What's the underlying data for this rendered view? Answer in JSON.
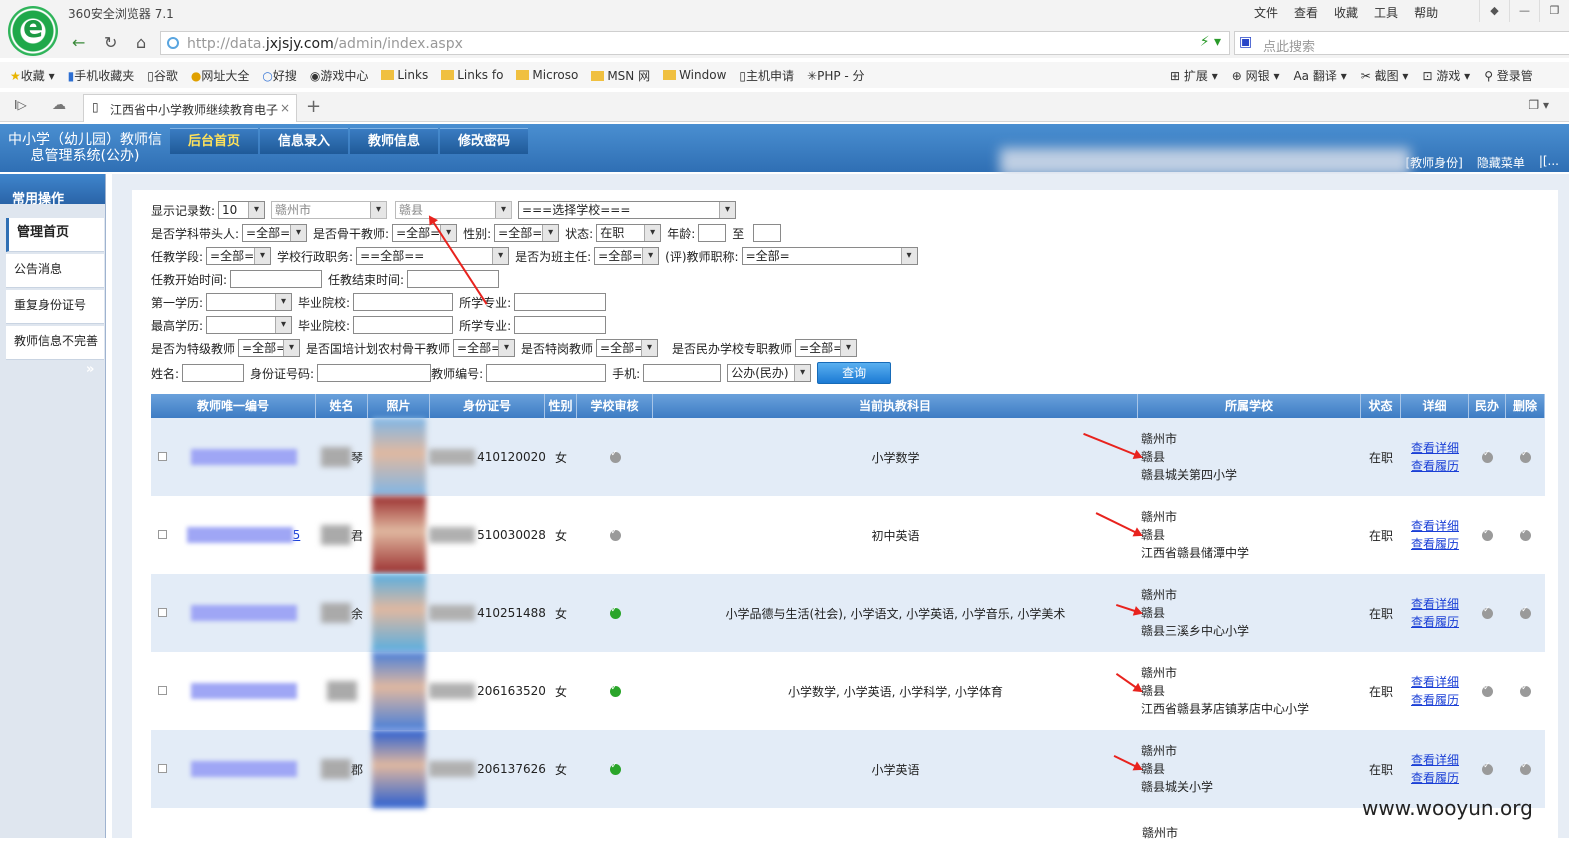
{
  "browser": {
    "app_title": "360安全浏览器 7.1",
    "menu": [
      "文件",
      "查看",
      "收藏",
      "工具",
      "帮助"
    ],
    "url_prefix": "http://data.",
    "url_domain": "jxjsjy.com",
    "url_path": "/admin/index.aspx",
    "search_placeholder": "点此搜索",
    "bookmarks": [
      "收藏",
      "手机收藏夹",
      "谷歌",
      "网址大全",
      "好搜",
      "游戏中心",
      "Links",
      "Links fo",
      "Microso",
      "MSN 网",
      "Window",
      "主机申请",
      "PHP - 分"
    ],
    "bookmarks_right": [
      "扩展",
      "网银",
      "翻译",
      "截图",
      "游戏",
      "登录管"
    ],
    "tab_title": "江西省中小学教师继续教育电子"
  },
  "site": {
    "title": "中小学（幼儿园）教师信息管理系统(公办)",
    "nav": [
      "后台首页",
      "信息录入",
      "教师信息",
      "修改密码"
    ],
    "header_links": [
      "[教师身份]",
      "隐藏菜单",
      "|[..."
    ]
  },
  "sidebar": {
    "heading": "常用操作",
    "items": [
      "管理首页",
      "公告消息",
      "重复身份证号",
      "教师信息不完善"
    ]
  },
  "filters": {
    "row1": {
      "label": "显示记录数:",
      "count": "10",
      "city": "赣州市",
      "county": "赣县",
      "school": "===选择学校==="
    },
    "row2": {
      "l1": "是否学科带头人:",
      "v1": "=全部=",
      "l2": "是否骨干教师:",
      "v2": "=全部=",
      "l3": "性别:",
      "v3": "=全部=",
      "l4": "状态:",
      "v4": "在职",
      "l5": "年龄:",
      "l6": "至"
    },
    "row3": {
      "l1": "任教学段:",
      "v1": "=全部=",
      "l2": "学校行政职务:",
      "v2": "==全部==",
      "l3": "是否为班主任:",
      "v3": "=全部=",
      "l4": "(评)教师职称:",
      "v4": "=全部="
    },
    "row4": {
      "l1": "任教开始时间:",
      "l2": "任教结束时间:"
    },
    "row5": {
      "l1": "第一学历:",
      "l2": "毕业院校:",
      "l3": "所学专业:"
    },
    "row6": {
      "l1": "最高学历:",
      "l2": "毕业院校:",
      "l3": "所学专业:"
    },
    "row7": {
      "l1": "是否为特级教师",
      "v1": "=全部=",
      "l2": "是否国培计划农村骨干教师",
      "v2": "=全部=",
      "l3": "是否特岗教师",
      "v3": "=全部=",
      "l4": "是否民办学校专职教师",
      "v4": "=全部="
    },
    "row8": {
      "l1": "姓名:",
      "l2": "身份证号码:",
      "l3": "教师编号:",
      "l4": "手机:",
      "v1": "公办(民办)",
      "button": "查询"
    }
  },
  "table": {
    "headers": [
      "教师唯一编号",
      "姓名",
      "照片",
      "身份证号",
      "性别",
      "学校审核",
      "当前执教科目",
      "所属学校",
      "状态",
      "详细",
      "民办",
      "删除"
    ],
    "rows": [
      {
        "id_suffix": "",
        "name_tail": "琴",
        "id_num": "410120020",
        "gender": "女",
        "audit_ok": false,
        "subject": "小学数学",
        "city": "赣州市",
        "county": "赣县",
        "school": "赣县城关第四小学",
        "status": "在职",
        "link1": "查看详细",
        "link2": "查看履历",
        "photo": "#7fb6e6"
      },
      {
        "id_suffix": "5",
        "name_tail": "君",
        "id_num": "510030028",
        "gender": "女",
        "audit_ok": false,
        "subject": "初中英语",
        "city": "赣州市",
        "county": "赣县",
        "school": "江西省赣县储潭中学",
        "status": "在职",
        "link1": "查看详细",
        "link2": "查看履历",
        "photo": "#9b3030"
      },
      {
        "id_suffix": "",
        "name_tail": "余",
        "id_num": "410251488",
        "gender": "女",
        "audit_ok": true,
        "subject": "小学品德与生活(社会), 小学语文, 小学英语, 小学音乐, 小学美术",
        "city": "赣州市",
        "county": "赣县",
        "school": "赣县三溪乡中心小学",
        "status": "在职",
        "link1": "查看详细",
        "link2": "查看履历",
        "photo": "#59aee0"
      },
      {
        "id_suffix": "",
        "name_tail": "",
        "id_num": "206163520",
        "gender": "女",
        "audit_ok": true,
        "subject": "小学数学, 小学英语, 小学科学, 小学体育",
        "city": "赣州市",
        "county": "赣县",
        "school": "江西省赣县茅店镇茅店中心小学",
        "status": "在职",
        "link1": "查看详细",
        "link2": "查看履历",
        "photo": "#4a7fd8"
      },
      {
        "id_suffix": "",
        "name_tail": "郡",
        "id_num": "206137626",
        "gender": "女",
        "audit_ok": true,
        "subject": "小学英语",
        "city": "赣州市",
        "county": "赣县",
        "school": "赣县城关小学",
        "status": "在职",
        "link1": "查看详细",
        "link2": "查看履历",
        "photo": "#2b5fd0"
      }
    ],
    "next_row_peek": "赣州市"
  },
  "watermark": "www.wooyun.org"
}
